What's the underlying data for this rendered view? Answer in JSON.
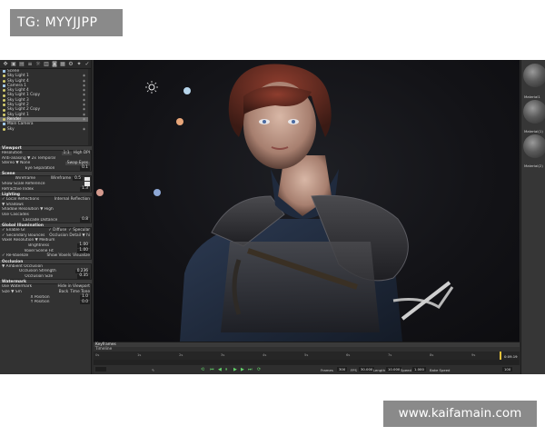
{
  "badges": {
    "top_left": "TG: MYYJJPP",
    "bottom_right": "www.kaifamain.com"
  },
  "toolbar": {
    "icons": [
      "move-icon",
      "scene-icon",
      "folder-icon",
      "list-icon",
      "light-icon",
      "filter-icon",
      "camera-icon",
      "layer-icon",
      "settings-icon",
      "gear-icon",
      "check-icon"
    ]
  },
  "scene_tree": {
    "items": [
      {
        "label": "Scene",
        "icon": "folder-icon"
      },
      {
        "label": "Sky Light 1",
        "icon": "light-icon"
      },
      {
        "label": "Sky Light 4",
        "icon": "light-icon"
      },
      {
        "label": "Camera 1",
        "icon": "camera-icon"
      },
      {
        "label": "Sky Light 4",
        "icon": "light-icon"
      },
      {
        "label": "Sky Light 1 Copy",
        "icon": "light-icon"
      },
      {
        "label": "Sky Light 3",
        "icon": "light-icon"
      },
      {
        "label": "Sky Light 2",
        "icon": "light-icon"
      },
      {
        "label": "Sky Light 2 Copy",
        "icon": "light-icon"
      },
      {
        "label": "Sky Light 1",
        "icon": "light-icon"
      },
      {
        "label": "Render",
        "icon": "light-icon",
        "selected": true
      },
      {
        "label": "Main Camera",
        "icon": "camera-icon"
      },
      {
        "label": "Sky",
        "icon": "light-icon"
      }
    ]
  },
  "viewport_panel": {
    "title": "Viewport",
    "resolution_label": "Resolution",
    "resolution_value": "1:1",
    "resolution_mode": "High DPI",
    "anti_aliasing": "Anti-aliasing ▼ 2x Temporal",
    "stereo": "Stereo ▼ None",
    "swap_eyes": "Swap Eyes",
    "eye_separation_label": "Eye Separation",
    "eye_separation_value": "0.1"
  },
  "scene_panel": {
    "title": "Scene",
    "wireframe_label": "Wireframe",
    "wireframe_mode": "Wireframe",
    "wireframe_value": "0.5",
    "show_scale_label": "Show Scale Reference",
    "refraction_label": "Refractive Index",
    "refraction_value": "1.3"
  },
  "lighting_panel": {
    "title": "Lighting",
    "local_reflections": "✓ Local Reflections",
    "internal_reflection": "Internal Reflection",
    "shadows": "▼ Shadows",
    "shadow_resolution": "Shadow Resolution ▼ High",
    "use_cascades": "Use Cascades",
    "cascade_distance_label": "Cascade Distance",
    "cascade_distance_value": "0.8"
  },
  "gi_panel": {
    "title": "Global Illumination",
    "enable_gi": "✓ Enable GI",
    "diffuse": "✓ Diffuse",
    "specular": "✓ Specular",
    "secondary_bounces": "✓ Secondary Bounces",
    "occlusion_detail": "Occlusion Detail ▼ hi",
    "voxel_resolution": "Voxel Resolution ▼ Medium",
    "brightness_label": "Brightness",
    "brightness_value": "1.00",
    "voxel_scene_fit_label": "Voxel Scene Fit",
    "voxel_scene_fit_value": "1.00",
    "revoxelize": "✓ Re-Voxelize",
    "show_voxels": "Show Voxels",
    "visualize": "Visualize"
  },
  "ao_panel": {
    "title": "Occlusion",
    "ambient_occlusion": "▼ Ambient Occlusion",
    "strength_label": "Occlusion Strength",
    "strength_value": "0.236",
    "size_label": "Occlusion Size",
    "size_value": "0.35"
  },
  "watermark_panel": {
    "title": "Watermark",
    "use_watermark": "Use Watermark",
    "hide_in_viewport": "Hide in Viewport",
    "size_label": "Size ▼ Sm",
    "back": "Back",
    "time_tone": "Time Tone",
    "x_label": "X Position",
    "x_value": "1.0",
    "y_label": "Y Position",
    "y_value": "0.0"
  },
  "materials": [
    {
      "label": "Material1"
    },
    {
      "label": "Material(1)"
    },
    {
      "label": "Material(2)"
    }
  ],
  "timeline": {
    "title": "Keyframes",
    "subtitle": "Timeline",
    "ticks": [
      "0s",
      "1s",
      "2s",
      "3s",
      "4s",
      "5s",
      "6s",
      "7s",
      "8s",
      "9s"
    ],
    "end_time": "0:09.19",
    "frames_label": "Frames",
    "frames_value": "300",
    "fps_label": "FPS",
    "fps_value": "30.000",
    "length_label": "Length",
    "length_value": "10.000",
    "speed_label": "Speed",
    "speed_value": "1.000",
    "bake_speed": "Bake Speed",
    "zoom_value": "100"
  }
}
